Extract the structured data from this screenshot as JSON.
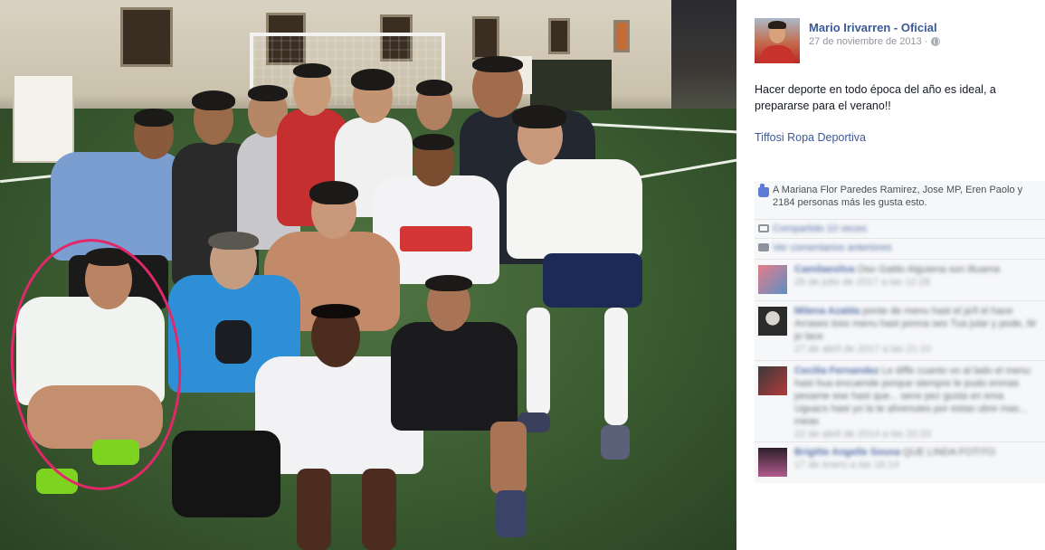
{
  "post": {
    "page_name": "Mario Irivarren - Oficial",
    "date": "27 de noviembre de 2013 ·",
    "text": "Hacer deporte en todo época del año es ideal, a prepararse para el verano!!",
    "tag_link": "Tiffosi Ropa Deportiva"
  },
  "ufi": {
    "likes": "A Mariana Flor Paredes Ramirez, Jose MP, Eren Paolo y 2184 personas más les gusta esto.",
    "shares": "Compartido 10 veces",
    "view_more": "Ver comentarios anteriores",
    "comments": [
      {
        "name": "Camilaesilva",
        "text": "Oso Gatito Alguienа son iltuama",
        "time": "26 de julio de 2017 a las 12:28"
      },
      {
        "name": "Milena Azalda",
        "text": "ponte de menu hast el ja'll el hace Arrases toss menu hast ponna ses Tua jular y pode, liir jo lace",
        "time": "27 de abril de 2017 a las 21:10"
      },
      {
        "name": "Cecilia Fernandez",
        "text": "Le diffe cuanto vo al lado el menu hast hua encuende porque siempre le pudo enmas pesame ese hast que... sens pez gusta en ema Uguacs hast yo la te ahrenuies por estas ubre mas... meas",
        "time": "22 de abril de 2014 a las 20:33"
      },
      {
        "name": "Brigitte Angelle Sousa",
        "text": "QUE LINDA FOTITO",
        "time": "17 de enero a las 16:14"
      }
    ]
  },
  "icons": {
    "privacy": "globe-icon",
    "like": "thumbs-up-icon",
    "share": "share-icon",
    "comment": "comment-icon"
  },
  "colors": {
    "link": "#3b5998",
    "highlight_circle": "#e0286a",
    "ufi_background": "#f6f7f9"
  }
}
